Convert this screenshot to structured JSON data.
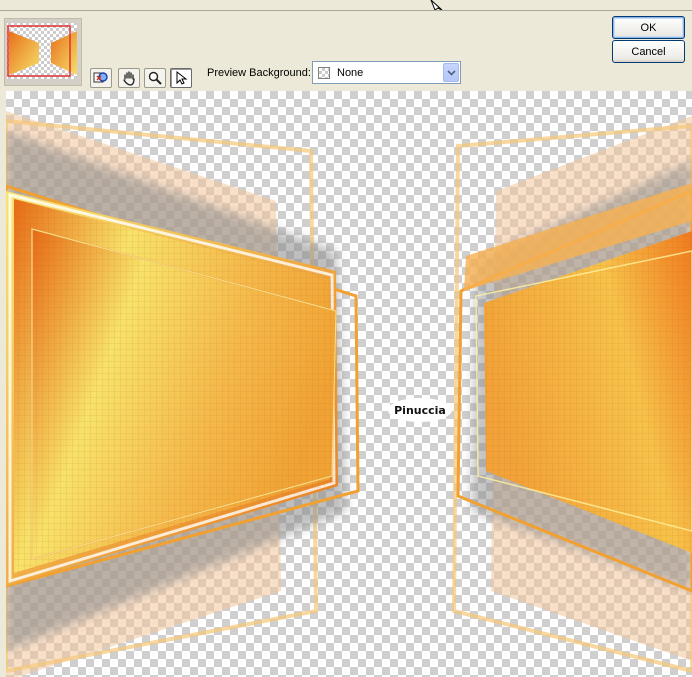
{
  "toolbar": {
    "preview_background_label": "Preview Background:",
    "preview_background_value": "None",
    "tools": [
      "pan-zoom-icon",
      "hand-icon",
      "magnifier-icon",
      "pointer-icon"
    ],
    "active_tool": "pointer-icon"
  },
  "buttons": {
    "ok_label": "OK",
    "cancel_label": "Cancel"
  },
  "preview": {
    "watermark": "Pinuccia",
    "colors": {
      "orange": "#f08a1a",
      "yellow": "#f7e870",
      "peach": "#f3c49a"
    }
  }
}
